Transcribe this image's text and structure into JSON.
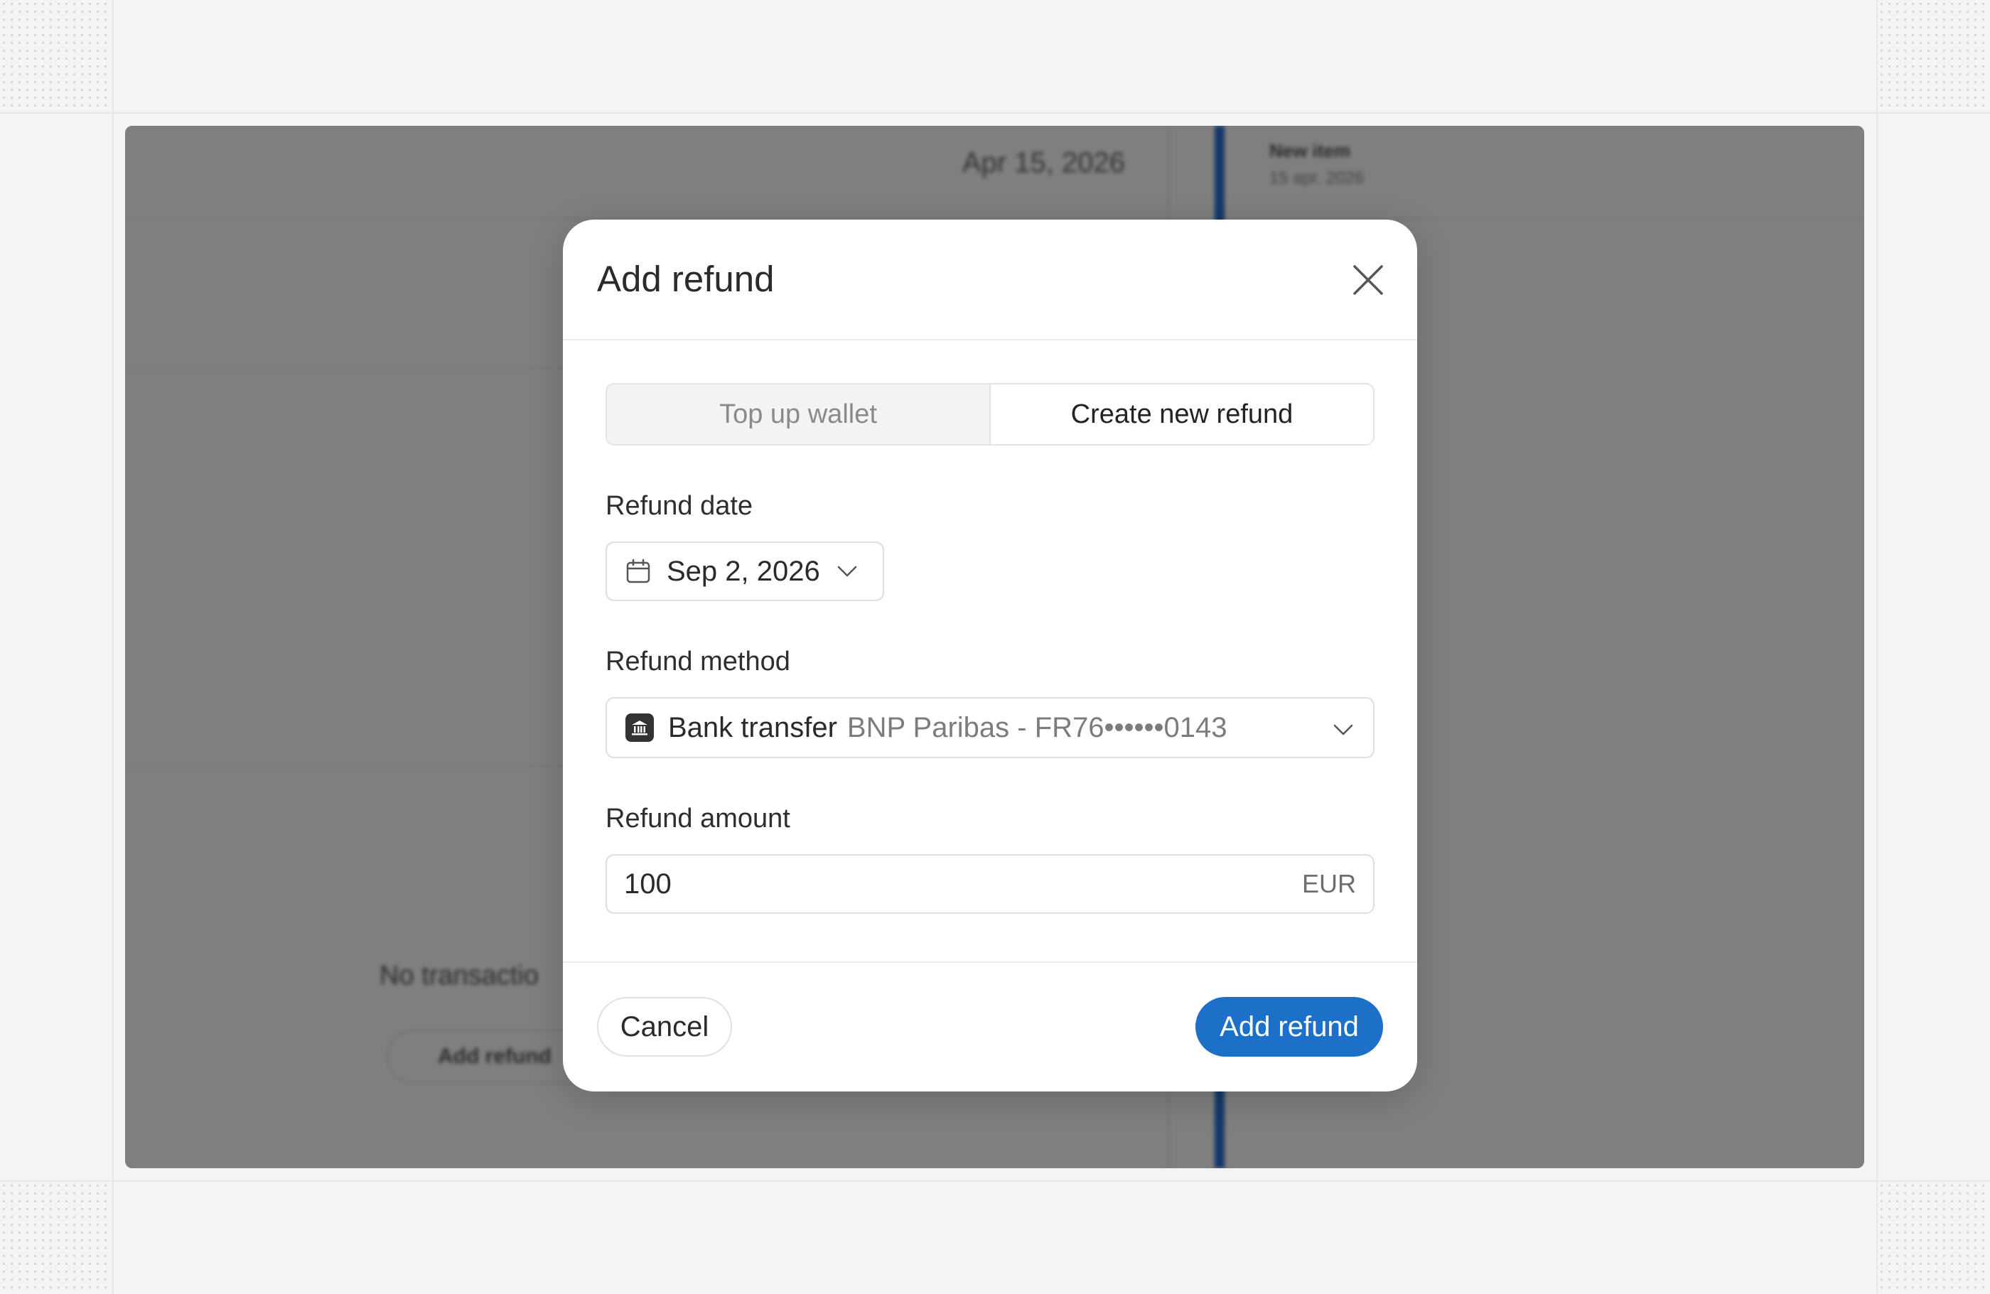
{
  "background": {
    "date": "Apr 15, 2026",
    "timeline_item_title": "New item",
    "timeline_item_subtitle": "15 apr. 2026",
    "empty_state_text": "No transactio",
    "empty_state_button": "Add refund"
  },
  "modal": {
    "title": "Add refund",
    "close_icon": "close-icon",
    "tabs": [
      {
        "label": "Top up wallet",
        "active": false
      },
      {
        "label": "Create new refund",
        "active": true
      }
    ],
    "refund_date": {
      "label": "Refund date",
      "value": "Sep 2, 2026",
      "icon": "calendar-icon"
    },
    "refund_method": {
      "label": "Refund method",
      "method": "Bank transfer",
      "detail": "BNP Paribas - FR76••••••0143",
      "icon": "bank-icon"
    },
    "refund_amount": {
      "label": "Refund amount",
      "value": "100",
      "currency": "EUR"
    },
    "footer": {
      "cancel_label": "Cancel",
      "submit_label": "Add refund"
    }
  },
  "colors": {
    "primary": "#1c70c8",
    "timeline": "#2a6fd6"
  }
}
